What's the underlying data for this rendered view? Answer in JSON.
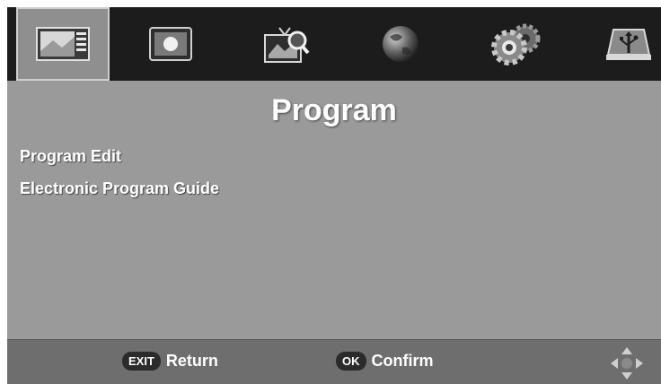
{
  "menu": {
    "title": "Program",
    "items": [
      {
        "label": "Program Edit"
      },
      {
        "label": "Electronic Program Guide"
      }
    ],
    "tabs": [
      {
        "icon": "program-icon",
        "selected": true
      },
      {
        "icon": "picture-icon",
        "selected": false
      },
      {
        "icon": "channel-search-icon",
        "selected": false
      },
      {
        "icon": "time-globe-icon",
        "selected": false
      },
      {
        "icon": "option-gears-icon",
        "selected": false
      },
      {
        "icon": "usb-icon",
        "selected": false
      }
    ]
  },
  "footer": {
    "exit_key": "EXIT",
    "exit_label": "Return",
    "ok_key": "OK",
    "ok_label": "Confirm"
  }
}
